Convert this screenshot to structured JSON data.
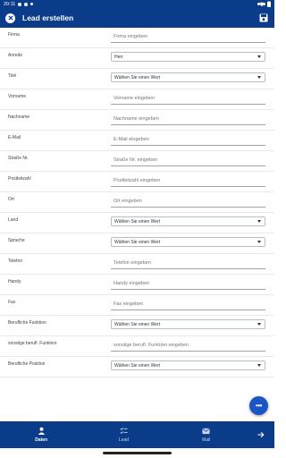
{
  "status": {
    "time": "20:11"
  },
  "app_bar": {
    "title": "Lead erstellen"
  },
  "form": {
    "rows": [
      {
        "label": "Firma",
        "type": "text",
        "placeholder": "Firma eingeben"
      },
      {
        "label": "Anrede",
        "type": "select",
        "value": "Herr"
      },
      {
        "label": "Titel",
        "type": "select",
        "value": "Wählen Sie einen Wert"
      },
      {
        "label": "Vorname",
        "type": "text",
        "placeholder": "Vorname eingeben"
      },
      {
        "label": "Nachname",
        "type": "text",
        "placeholder": "Nachname eingeben"
      },
      {
        "label": "E-Mail",
        "type": "text",
        "placeholder": "E-Mail eingeben"
      },
      {
        "label": "Straße Nr.",
        "type": "text",
        "placeholder": "Straße Nr. eingeben"
      },
      {
        "label": "Postleitzahl",
        "type": "text",
        "placeholder": "Postleitzahl eingeben"
      },
      {
        "label": "Ort",
        "type": "text",
        "placeholder": "Ort eingeben"
      },
      {
        "label": "Land",
        "type": "select",
        "value": "Wählen Sie einen Wert"
      },
      {
        "label": "Sprache",
        "type": "select",
        "value": "Wählen Sie einen Wert"
      },
      {
        "label": "Telefon",
        "type": "text",
        "placeholder": "Telefon eingeben"
      },
      {
        "label": "Handy",
        "type": "text",
        "placeholder": "Handy eingeben"
      },
      {
        "label": "Fax",
        "type": "text",
        "placeholder": "Fax eingeben"
      },
      {
        "label": "Berufliche Funktion",
        "type": "select",
        "value": "Wählen Sie einen Wert"
      },
      {
        "label": "sonstige berufl. Funktion",
        "type": "text",
        "placeholder": "sonstige berufl. Funktion eingeben"
      },
      {
        "label": "Berufliche Position",
        "type": "select",
        "value": "Wählen Sie einen Wert"
      }
    ]
  },
  "fab": {
    "label": "•••"
  },
  "bottom_nav": {
    "items": [
      {
        "label": "Daten",
        "icon": "person-icon"
      },
      {
        "label": "Lead",
        "icon": "checklist-icon"
      },
      {
        "label": "Mail",
        "icon": "mail-icon"
      }
    ]
  },
  "colors": {
    "primary": "#0a3c8a",
    "fab": "#1a56c4"
  }
}
